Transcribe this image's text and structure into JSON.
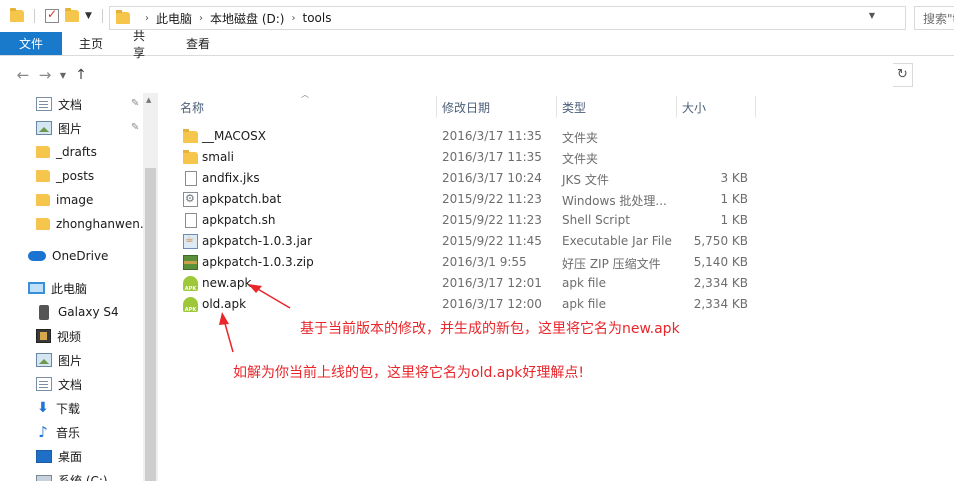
{
  "tabs": {
    "file": "文件",
    "home": "主页",
    "share": "共享",
    "view": "查看"
  },
  "address": {
    "crumbs": [
      "此电脑",
      "本地磁盘 (D:)",
      "tools"
    ],
    "search_placeholder": "搜索\"t"
  },
  "nav": {
    "items": [
      {
        "label": "文档",
        "icon": "document-icon",
        "pinned": true
      },
      {
        "label": "图片",
        "icon": "picture-icon",
        "pinned": true
      },
      {
        "label": "_drafts",
        "icon": "folder-icon"
      },
      {
        "label": "_posts",
        "icon": "folder-icon"
      },
      {
        "label": "image",
        "icon": "folder-icon"
      },
      {
        "label": "zhonghanwen.g",
        "icon": "folder-icon"
      },
      {
        "label": "OneDrive",
        "icon": "onedrive-icon"
      },
      {
        "label": "此电脑",
        "icon": "this-pc-icon"
      },
      {
        "label": "Galaxy S4",
        "icon": "phone-icon"
      },
      {
        "label": "视频",
        "icon": "video-icon"
      },
      {
        "label": "图片",
        "icon": "picture-icon"
      },
      {
        "label": "文档",
        "icon": "document-icon"
      },
      {
        "label": "下载",
        "icon": "download-icon"
      },
      {
        "label": "音乐",
        "icon": "music-icon"
      },
      {
        "label": "桌面",
        "icon": "desktop-icon"
      },
      {
        "label": "系统 (C:)",
        "icon": "drive-icon"
      }
    ]
  },
  "columns": {
    "name": "名称",
    "date": "修改日期",
    "type": "类型",
    "size": "大小"
  },
  "files": [
    {
      "name": "__MACOSX",
      "date": "2016/3/17 11:35",
      "type": "文件夹",
      "size": "",
      "icon": "folder-icon"
    },
    {
      "name": "smali",
      "date": "2016/3/17 11:35",
      "type": "文件夹",
      "size": "",
      "icon": "folder-icon"
    },
    {
      "name": "andfix.jks",
      "date": "2016/3/17 10:24",
      "type": "JKS 文件",
      "size": "3 KB",
      "icon": "file-icon"
    },
    {
      "name": "apkpatch.bat",
      "date": "2015/9/22 11:23",
      "type": "Windows 批处理...",
      "size": "1 KB",
      "icon": "bat-icon"
    },
    {
      "name": "apkpatch.sh",
      "date": "2015/9/22 11:23",
      "type": "Shell Script",
      "size": "1 KB",
      "icon": "file-icon"
    },
    {
      "name": "apkpatch-1.0.3.jar",
      "date": "2015/9/22 11:45",
      "type": "Executable Jar File",
      "size": "5,750 KB",
      "icon": "jar-icon"
    },
    {
      "name": "apkpatch-1.0.3.zip",
      "date": "2016/3/1 9:55",
      "type": "好压 ZIP 压缩文件",
      "size": "5,140 KB",
      "icon": "zip-icon"
    },
    {
      "name": "new.apk",
      "date": "2016/3/17 12:01",
      "type": "apk file",
      "size": "2,334 KB",
      "icon": "apk-icon"
    },
    {
      "name": "old.apk",
      "date": "2016/3/17 12:00",
      "type": "apk file",
      "size": "2,334 KB",
      "icon": "apk-icon"
    }
  ],
  "annotations": {
    "new_apk": "基于当前版本的修改，并生成的新包，这里将它名为new.apk",
    "old_apk": "如解为你当前上线的包，这里将它名为old.apk好理解点!"
  },
  "colors": {
    "accent": "#1979ca",
    "annotation": "#e8262b"
  }
}
